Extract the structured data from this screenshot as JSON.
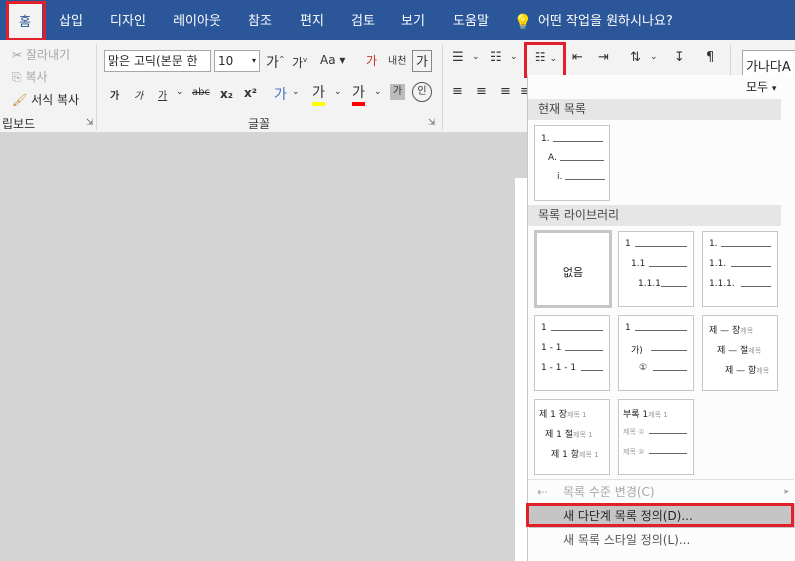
{
  "tabs": [
    {
      "label": "홈",
      "active": true
    },
    {
      "label": "삽입"
    },
    {
      "label": "디자인"
    },
    {
      "label": "레이아웃"
    },
    {
      "label": "참조"
    },
    {
      "label": "편지"
    },
    {
      "label": "검토"
    },
    {
      "label": "보기"
    },
    {
      "label": "도움말"
    }
  ],
  "tell_me": "어떤 작업을 원하시나요?",
  "clipboard": {
    "cut": "잘라내기",
    "copy": "복사",
    "format_painter": "서식 복사",
    "label": "립보드"
  },
  "font": {
    "name": "맑은 고딕(본문 한",
    "size": "10",
    "label": "글꼴",
    "buttons": {
      "grow": "가",
      "shrink": "가",
      "case": "Aa",
      "clear": "가",
      "phonetic": "내천",
      "charborder": "가",
      "bold": "가",
      "italic": "가",
      "underline": "가",
      "strike": "abc",
      "sub": "x₂",
      "sup": "x²",
      "effects": "가",
      "highlight": "가",
      "color": "가",
      "shade": "가",
      "enclose": "인"
    }
  },
  "style_preview": "가나다A",
  "dropdown": {
    "filter": "모두",
    "current_header": "현재 목록",
    "library_header": "목록 라이브러리",
    "current_list": [
      "1.",
      "A.",
      "i."
    ],
    "none_label": "없음",
    "lib": {
      "a": [
        "1",
        "1.1",
        "1.1.1"
      ],
      "b": [
        "1.",
        "1.1.",
        "1.1.1."
      ],
      "c": [
        "1",
        "1 - 1",
        "1 - 1 - 1"
      ],
      "d": [
        "1",
        "가)",
        "①"
      ],
      "e": [
        "제 — 장",
        "제 — 절",
        "제 — 항"
      ],
      "f": [
        "제 1 장",
        "제 1 절",
        "제 1 항"
      ],
      "g": [
        "부록 1",
        "제목 ①",
        "제목 ②"
      ],
      "e_suffix": "제목",
      "f_suffix": "제목 1",
      "g_suffix": "제목 1"
    },
    "items": {
      "change_level": "목록 수준 변경(C)",
      "define_multilevel": "새 다단계 목록 정의(D)...",
      "define_style": "새 목록 스타일 정의(L)..."
    }
  },
  "colors": {
    "accent": "#2b579a",
    "highlight_box": "#e0202a",
    "highlight_yellow": "#ffff00",
    "font_red": "#ff0000"
  }
}
